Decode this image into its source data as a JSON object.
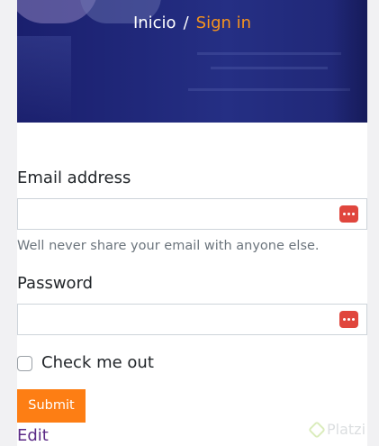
{
  "breadcrumb": {
    "home": "Inicio",
    "separator": "/",
    "current": "Sign in"
  },
  "form": {
    "email": {
      "label": "Email address",
      "value": "",
      "help": "Well never share your email with anyone else."
    },
    "password": {
      "label": "Password",
      "value": ""
    },
    "checkbox": {
      "label": "Check me out",
      "checked": false
    },
    "submit_label": "Submit"
  },
  "edit_link": "Edit",
  "watermark": "Platzi",
  "colors": {
    "hero_bg": "#20287a",
    "breadcrumb_active": "#f7941d",
    "submit_bg": "#fd7e14",
    "link": "#5b2a86",
    "password_manager_icon": "#e0463d"
  },
  "icons": {
    "password_manager": "password-manager-icon",
    "watermark": "platzi-logo-icon"
  }
}
